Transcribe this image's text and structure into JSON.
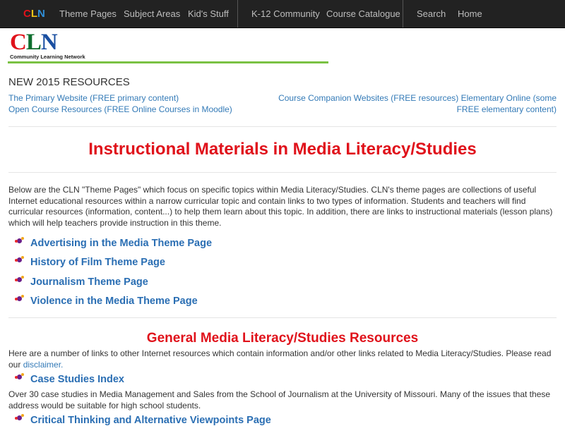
{
  "navbar": {
    "brand": [
      "C",
      "L",
      "N"
    ],
    "brand_colors": [
      "#e0121b",
      "#f2c417",
      "#2f8fd8"
    ],
    "items": [
      "Theme Pages",
      "Subject Areas",
      "Kid's Stuff",
      "K-12 Community",
      "Course Catalogue",
      "Search",
      "Home"
    ]
  },
  "logo": {
    "letters": [
      "C",
      "L",
      "N"
    ],
    "letter_colors": [
      "#e0121b",
      "#0e6e2e",
      "#1a4fa1"
    ],
    "tagline": "Community Learning Network"
  },
  "new_resources": {
    "title": "NEW 2015 RESOURCES",
    "left_links": [
      "The Primary Website (FREE primary content)",
      "Open Course Resources (FREE Online Courses in Moodle)"
    ],
    "right_links": [
      "Course Companion Websites (FREE resources) Elementary Online (some",
      "FREE elementary content)"
    ]
  },
  "main": {
    "title": "Instructional Materials in Media Literacy/Studies",
    "intro": "Below are the CLN \"Theme Pages\" which focus on specific topics within Media Literacy/Studies. CLN's theme pages are collections of useful Internet educational resources within a narrow curricular topic and contain links to two types of information. Students and teachers will find curricular resources (information, content...) to help them learn about this topic. In addition, there are links to instructional materials (lesson plans) which will help teachers provide instruction in this theme.",
    "theme_pages": [
      "Advertising in the Media Theme Page",
      "History of Film Theme Page",
      "Journalism Theme Page",
      "Violence in the Media Theme Page"
    ]
  },
  "general": {
    "title": "General Media Literacy/Studies Resources",
    "text": "Here are a number of links to other Internet resources which contain information and/or other links related to Media Literacy/Studies. Please read our",
    "disclaimer_link": "disclaimer.",
    "resources": [
      {
        "title": "Case Studies Index",
        "description": "Over 30 case studies in Media Management and Sales from the School of Journalism at the University of Missouri. Many of the issues that these address would be suitable for high school students."
      },
      {
        "title": "Critical Thinking and Alternative Viewpoints Page",
        "description": ""
      }
    ]
  }
}
